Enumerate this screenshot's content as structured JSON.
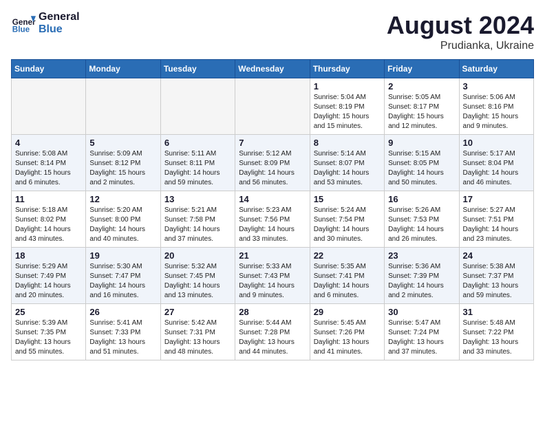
{
  "logo": {
    "line1": "General",
    "line2": "Blue"
  },
  "title": "August 2024",
  "subtitle": "Prudianka, Ukraine",
  "weekdays": [
    "Sunday",
    "Monday",
    "Tuesday",
    "Wednesday",
    "Thursday",
    "Friday",
    "Saturday"
  ],
  "weeks": [
    [
      {
        "day": "",
        "sunrise": "",
        "sunset": "",
        "daylight": ""
      },
      {
        "day": "",
        "sunrise": "",
        "sunset": "",
        "daylight": ""
      },
      {
        "day": "",
        "sunrise": "",
        "sunset": "",
        "daylight": ""
      },
      {
        "day": "",
        "sunrise": "",
        "sunset": "",
        "daylight": ""
      },
      {
        "day": "1",
        "sunrise": "Sunrise: 5:04 AM",
        "sunset": "Sunset: 8:19 PM",
        "daylight": "Daylight: 15 hours and 15 minutes."
      },
      {
        "day": "2",
        "sunrise": "Sunrise: 5:05 AM",
        "sunset": "Sunset: 8:17 PM",
        "daylight": "Daylight: 15 hours and 12 minutes."
      },
      {
        "day": "3",
        "sunrise": "Sunrise: 5:06 AM",
        "sunset": "Sunset: 8:16 PM",
        "daylight": "Daylight: 15 hours and 9 minutes."
      }
    ],
    [
      {
        "day": "4",
        "sunrise": "Sunrise: 5:08 AM",
        "sunset": "Sunset: 8:14 PM",
        "daylight": "Daylight: 15 hours and 6 minutes."
      },
      {
        "day": "5",
        "sunrise": "Sunrise: 5:09 AM",
        "sunset": "Sunset: 8:12 PM",
        "daylight": "Daylight: 15 hours and 2 minutes."
      },
      {
        "day": "6",
        "sunrise": "Sunrise: 5:11 AM",
        "sunset": "Sunset: 8:11 PM",
        "daylight": "Daylight: 14 hours and 59 minutes."
      },
      {
        "day": "7",
        "sunrise": "Sunrise: 5:12 AM",
        "sunset": "Sunset: 8:09 PM",
        "daylight": "Daylight: 14 hours and 56 minutes."
      },
      {
        "day": "8",
        "sunrise": "Sunrise: 5:14 AM",
        "sunset": "Sunset: 8:07 PM",
        "daylight": "Daylight: 14 hours and 53 minutes."
      },
      {
        "day": "9",
        "sunrise": "Sunrise: 5:15 AM",
        "sunset": "Sunset: 8:05 PM",
        "daylight": "Daylight: 14 hours and 50 minutes."
      },
      {
        "day": "10",
        "sunrise": "Sunrise: 5:17 AM",
        "sunset": "Sunset: 8:04 PM",
        "daylight": "Daylight: 14 hours and 46 minutes."
      }
    ],
    [
      {
        "day": "11",
        "sunrise": "Sunrise: 5:18 AM",
        "sunset": "Sunset: 8:02 PM",
        "daylight": "Daylight: 14 hours and 43 minutes."
      },
      {
        "day": "12",
        "sunrise": "Sunrise: 5:20 AM",
        "sunset": "Sunset: 8:00 PM",
        "daylight": "Daylight: 14 hours and 40 minutes."
      },
      {
        "day": "13",
        "sunrise": "Sunrise: 5:21 AM",
        "sunset": "Sunset: 7:58 PM",
        "daylight": "Daylight: 14 hours and 37 minutes."
      },
      {
        "day": "14",
        "sunrise": "Sunrise: 5:23 AM",
        "sunset": "Sunset: 7:56 PM",
        "daylight": "Daylight: 14 hours and 33 minutes."
      },
      {
        "day": "15",
        "sunrise": "Sunrise: 5:24 AM",
        "sunset": "Sunset: 7:54 PM",
        "daylight": "Daylight: 14 hours and 30 minutes."
      },
      {
        "day": "16",
        "sunrise": "Sunrise: 5:26 AM",
        "sunset": "Sunset: 7:53 PM",
        "daylight": "Daylight: 14 hours and 26 minutes."
      },
      {
        "day": "17",
        "sunrise": "Sunrise: 5:27 AM",
        "sunset": "Sunset: 7:51 PM",
        "daylight": "Daylight: 14 hours and 23 minutes."
      }
    ],
    [
      {
        "day": "18",
        "sunrise": "Sunrise: 5:29 AM",
        "sunset": "Sunset: 7:49 PM",
        "daylight": "Daylight: 14 hours and 20 minutes."
      },
      {
        "day": "19",
        "sunrise": "Sunrise: 5:30 AM",
        "sunset": "Sunset: 7:47 PM",
        "daylight": "Daylight: 14 hours and 16 minutes."
      },
      {
        "day": "20",
        "sunrise": "Sunrise: 5:32 AM",
        "sunset": "Sunset: 7:45 PM",
        "daylight": "Daylight: 14 hours and 13 minutes."
      },
      {
        "day": "21",
        "sunrise": "Sunrise: 5:33 AM",
        "sunset": "Sunset: 7:43 PM",
        "daylight": "Daylight: 14 hours and 9 minutes."
      },
      {
        "day": "22",
        "sunrise": "Sunrise: 5:35 AM",
        "sunset": "Sunset: 7:41 PM",
        "daylight": "Daylight: 14 hours and 6 minutes."
      },
      {
        "day": "23",
        "sunrise": "Sunrise: 5:36 AM",
        "sunset": "Sunset: 7:39 PM",
        "daylight": "Daylight: 14 hours and 2 minutes."
      },
      {
        "day": "24",
        "sunrise": "Sunrise: 5:38 AM",
        "sunset": "Sunset: 7:37 PM",
        "daylight": "Daylight: 13 hours and 59 minutes."
      }
    ],
    [
      {
        "day": "25",
        "sunrise": "Sunrise: 5:39 AM",
        "sunset": "Sunset: 7:35 PM",
        "daylight": "Daylight: 13 hours and 55 minutes."
      },
      {
        "day": "26",
        "sunrise": "Sunrise: 5:41 AM",
        "sunset": "Sunset: 7:33 PM",
        "daylight": "Daylight: 13 hours and 51 minutes."
      },
      {
        "day": "27",
        "sunrise": "Sunrise: 5:42 AM",
        "sunset": "Sunset: 7:31 PM",
        "daylight": "Daylight: 13 hours and 48 minutes."
      },
      {
        "day": "28",
        "sunrise": "Sunrise: 5:44 AM",
        "sunset": "Sunset: 7:28 PM",
        "daylight": "Daylight: 13 hours and 44 minutes."
      },
      {
        "day": "29",
        "sunrise": "Sunrise: 5:45 AM",
        "sunset": "Sunset: 7:26 PM",
        "daylight": "Daylight: 13 hours and 41 minutes."
      },
      {
        "day": "30",
        "sunrise": "Sunrise: 5:47 AM",
        "sunset": "Sunset: 7:24 PM",
        "daylight": "Daylight: 13 hours and 37 minutes."
      },
      {
        "day": "31",
        "sunrise": "Sunrise: 5:48 AM",
        "sunset": "Sunset: 7:22 PM",
        "daylight": "Daylight: 13 hours and 33 minutes."
      }
    ]
  ]
}
